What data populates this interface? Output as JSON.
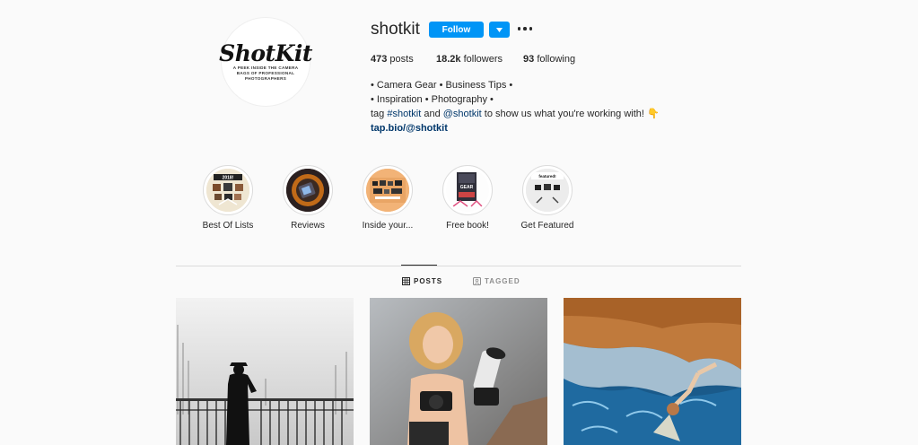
{
  "profile": {
    "avatar_logo": "ShotKit",
    "avatar_tagline": "A PEEK INSIDE THE CAMERA BAGS OF PROFESSIONAL PHOTOGRAPHERS",
    "username": "shotkit",
    "follow_label": "Follow",
    "stats": {
      "posts_count": "473",
      "posts_label": "posts",
      "followers_count": "18.2k",
      "followers_label": "followers",
      "following_count": "93",
      "following_label": "following"
    },
    "bio": {
      "line1": "• Camera Gear • Business Tips •",
      "line2": "• Inspiration • Photography •",
      "line3_prefix": "tag ",
      "hashtag": "#shotkit",
      "line3_mid": " and ",
      "mention": "@shotkit",
      "line3_suffix": " to show us what you're working with! 👇",
      "url": "tap.bio/@shotkit"
    }
  },
  "highlights": [
    {
      "label": "Best Of Lists",
      "cover_text": "2018!"
    },
    {
      "label": "Reviews"
    },
    {
      "label": "Inside your..."
    },
    {
      "label": "Free book!",
      "cover_text": "GEAR"
    },
    {
      "label": "Get Featured",
      "cover_text": "featured!"
    }
  ],
  "tabs": {
    "posts": "POSTS",
    "tagged": "TAGGED"
  },
  "colors": {
    "accent": "#0095f6",
    "text": "#262626",
    "link": "#00376b",
    "background": "#fafafa",
    "divider": "#dbdbdb"
  }
}
